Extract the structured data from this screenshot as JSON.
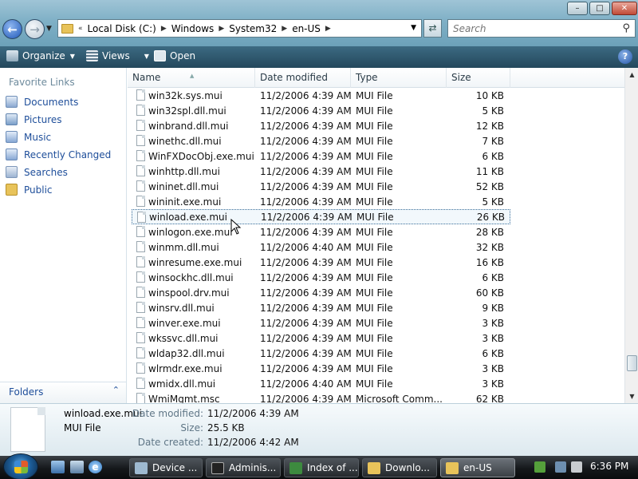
{
  "window": {
    "minimize_glyph": "–",
    "maximize_glyph": "□",
    "close_glyph": "✕"
  },
  "address": {
    "prefix": "«",
    "segments": [
      "Local Disk (C:)",
      "Windows",
      "System32",
      "en-US"
    ]
  },
  "search": {
    "placeholder": "Search"
  },
  "toolbar": {
    "organize": "Organize",
    "views": "Views",
    "open": "Open",
    "help": "?"
  },
  "sidebar": {
    "heading": "Favorite Links",
    "items": [
      {
        "label": "Documents",
        "icon": "documents-icon"
      },
      {
        "label": "Pictures",
        "icon": "pictures-icon"
      },
      {
        "label": "Music",
        "icon": "music-icon"
      },
      {
        "label": "Recently Changed",
        "icon": "recently-changed-icon"
      },
      {
        "label": "Searches",
        "icon": "searches-icon"
      },
      {
        "label": "Public",
        "icon": "public-folder-icon"
      }
    ],
    "folders_label": "Folders"
  },
  "columns": {
    "name": "Name",
    "date": "Date modified",
    "type": "Type",
    "size": "Size"
  },
  "files": [
    {
      "name": "win32k.sys.mui",
      "date": "11/2/2006 4:39 AM",
      "type": "MUI File",
      "size": "10 KB"
    },
    {
      "name": "win32spl.dll.mui",
      "date": "11/2/2006 4:39 AM",
      "type": "MUI File",
      "size": "5 KB"
    },
    {
      "name": "winbrand.dll.mui",
      "date": "11/2/2006 4:39 AM",
      "type": "MUI File",
      "size": "12 KB"
    },
    {
      "name": "winethc.dll.mui",
      "date": "11/2/2006 4:39 AM",
      "type": "MUI File",
      "size": "7 KB"
    },
    {
      "name": "WinFXDocObj.exe.mui",
      "date": "11/2/2006 4:39 AM",
      "type": "MUI File",
      "size": "6 KB"
    },
    {
      "name": "winhttp.dll.mui",
      "date": "11/2/2006 4:39 AM",
      "type": "MUI File",
      "size": "11 KB"
    },
    {
      "name": "wininet.dll.mui",
      "date": "11/2/2006 4:39 AM",
      "type": "MUI File",
      "size": "52 KB"
    },
    {
      "name": "wininit.exe.mui",
      "date": "11/2/2006 4:39 AM",
      "type": "MUI File",
      "size": "5 KB"
    },
    {
      "name": "winload.exe.mui",
      "date": "11/2/2006 4:39 AM",
      "type": "MUI File",
      "size": "26 KB",
      "selected": true
    },
    {
      "name": "winlogon.exe.mui",
      "date": "11/2/2006 4:39 AM",
      "type": "MUI File",
      "size": "28 KB"
    },
    {
      "name": "winmm.dll.mui",
      "date": "11/2/2006 4:40 AM",
      "type": "MUI File",
      "size": "32 KB"
    },
    {
      "name": "winresume.exe.mui",
      "date": "11/2/2006 4:39 AM",
      "type": "MUI File",
      "size": "16 KB"
    },
    {
      "name": "winsockhc.dll.mui",
      "date": "11/2/2006 4:39 AM",
      "type": "MUI File",
      "size": "6 KB"
    },
    {
      "name": "winspool.drv.mui",
      "date": "11/2/2006 4:39 AM",
      "type": "MUI File",
      "size": "60 KB"
    },
    {
      "name": "winsrv.dll.mui",
      "date": "11/2/2006 4:39 AM",
      "type": "MUI File",
      "size": "9 KB"
    },
    {
      "name": "winver.exe.mui",
      "date": "11/2/2006 4:39 AM",
      "type": "MUI File",
      "size": "3 KB"
    },
    {
      "name": "wkssvc.dll.mui",
      "date": "11/2/2006 4:39 AM",
      "type": "MUI File",
      "size": "3 KB"
    },
    {
      "name": "wldap32.dll.mui",
      "date": "11/2/2006 4:39 AM",
      "type": "MUI File",
      "size": "6 KB"
    },
    {
      "name": "wlrmdr.exe.mui",
      "date": "11/2/2006 4:39 AM",
      "type": "MUI File",
      "size": "3 KB"
    },
    {
      "name": "wmidx.dll.mui",
      "date": "11/2/2006 4:40 AM",
      "type": "MUI File",
      "size": "3 KB"
    },
    {
      "name": "WmiMgmt.msc",
      "date": "11/2/2006 4:39 AM",
      "type": "Microsoft Comm...",
      "size": "62 KB"
    }
  ],
  "details": {
    "name": "winload.exe.mui",
    "type": "MUI File",
    "date_modified_label": "Date modified:",
    "date_modified": "11/2/2006 4:39 AM",
    "size_label": "Size:",
    "size": "25.5 KB",
    "date_created_label": "Date created:",
    "date_created": "11/2/2006 4:42 AM"
  },
  "taskbar": {
    "tasks": [
      {
        "label": "Device ...",
        "icon": "device-manager-icon"
      },
      {
        "label": "Adminis...",
        "icon": "command-prompt-icon"
      },
      {
        "label": "Index of ...",
        "icon": "browser-icon"
      },
      {
        "label": "Downlo...",
        "icon": "folder-icon"
      },
      {
        "label": "en-US",
        "icon": "folder-icon",
        "active": true
      }
    ],
    "clock": "6:36 PM"
  }
}
